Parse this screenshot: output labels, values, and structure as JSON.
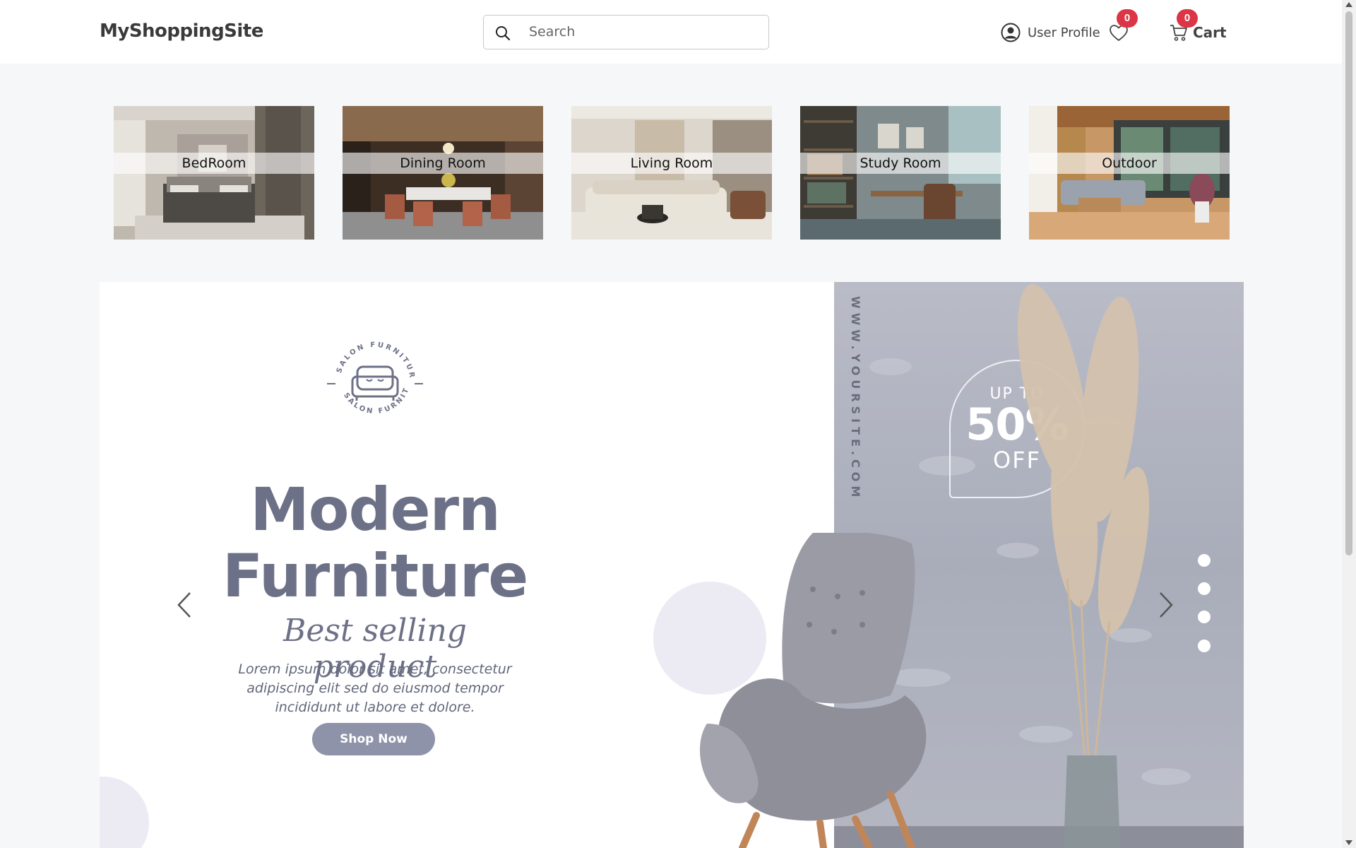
{
  "header": {
    "brand": "MyShoppingSite",
    "search_placeholder": "Search",
    "user_profile_label": "User Profile",
    "wishlist_count": "0",
    "cart_count": "0",
    "cart_label": "Cart",
    "badge_color": "#dc3545"
  },
  "categories": [
    {
      "label": "BedRoom"
    },
    {
      "label": "Dining Room"
    },
    {
      "label": "Living Room"
    },
    {
      "label": "Study Room"
    },
    {
      "label": "Outdoor"
    }
  ],
  "banner": {
    "website": "WWW.YOURSITE.COM",
    "discount_up_to": "UP TO",
    "discount_value": "50%",
    "discount_off": "OFF",
    "seal_text": "SALON FURNITURE",
    "headline_line1": "Modern",
    "headline_line2": "Furniture",
    "tagline": "Best selling product",
    "description": "Lorem ipsum dolor sit amet, consectetur adipiscing elit sed do eiusmod tempor incididunt ut labore et dolore.",
    "cta_label": "Shop Now",
    "slide_count": 4,
    "accent_color": "#6d7187"
  }
}
